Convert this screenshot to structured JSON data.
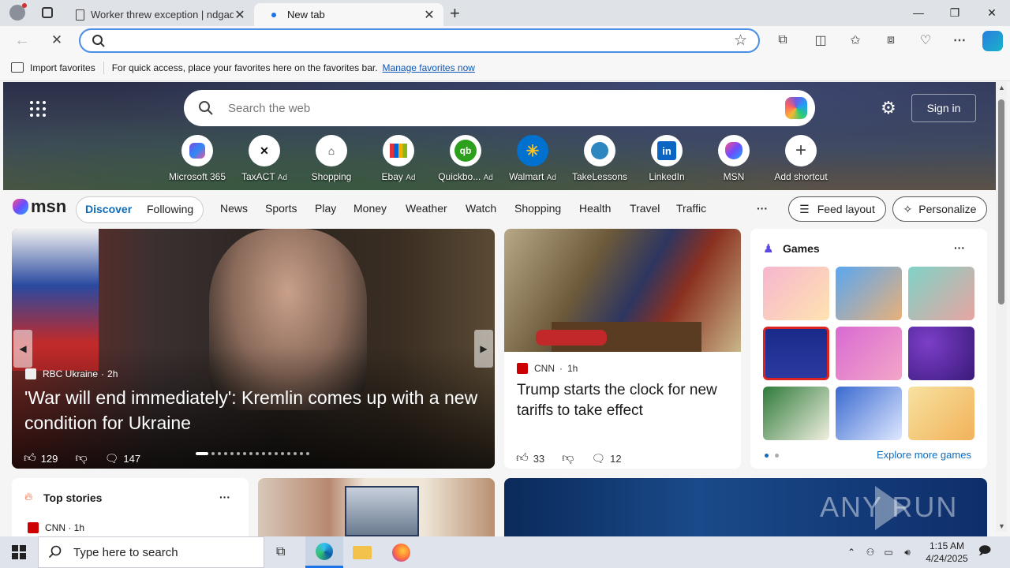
{
  "browser": {
    "tabs": [
      {
        "title": "Worker threw exception | ndgadf..."
      },
      {
        "title": "New tab"
      }
    ],
    "address_value": "",
    "favorites_bar": {
      "import_label": "Import favorites",
      "message": "For quick access, place your favorites here on the favorites bar.",
      "manage_link": "Manage favorites now"
    }
  },
  "newtab": {
    "search_placeholder": "Search the web",
    "sign_in": "Sign in",
    "quick_links": [
      {
        "label": "Microsoft 365",
        "ad": ""
      },
      {
        "label": "TaxACT",
        "ad": "Ad"
      },
      {
        "label": "Shopping",
        "ad": ""
      },
      {
        "label": "Ebay",
        "ad": "Ad"
      },
      {
        "label": "Quickbo...",
        "ad": "Ad"
      },
      {
        "label": "Walmart",
        "ad": "Ad"
      },
      {
        "label": "TakeLessons",
        "ad": ""
      },
      {
        "label": "LinkedIn",
        "ad": ""
      },
      {
        "label": "MSN",
        "ad": ""
      },
      {
        "label": "Add shortcut",
        "ad": ""
      }
    ]
  },
  "msn": {
    "logo": "msn",
    "pills": [
      "Discover",
      "Following"
    ],
    "nav": [
      "News",
      "Sports",
      "Play",
      "Money",
      "Weather",
      "Watch",
      "Shopping",
      "Health",
      "Travel",
      "Traffic"
    ],
    "more": "···",
    "feed_layout": "Feed layout",
    "personalize": "Personalize"
  },
  "main_story": {
    "source": "RBC Ukraine",
    "age": "2h",
    "headline": "'War will end immediately': Kremlin comes up with a new condition for Ukraine",
    "likes": "129",
    "comments": "147"
  },
  "cnn_story": {
    "source": "CNN",
    "age": "1h",
    "headline": "Trump starts the clock for new tariffs to take effect",
    "likes": "33",
    "comments": "12"
  },
  "games": {
    "title": "Games",
    "more": "···",
    "explore": "Explore more games"
  },
  "top_stories": {
    "title": "Top stories",
    "more": "···",
    "source": "CNN · 1h"
  },
  "watermark": "ANY RUN",
  "taskbar": {
    "search_placeholder": "Type here to search",
    "time": "1:15 AM",
    "date": "4/24/2025"
  }
}
